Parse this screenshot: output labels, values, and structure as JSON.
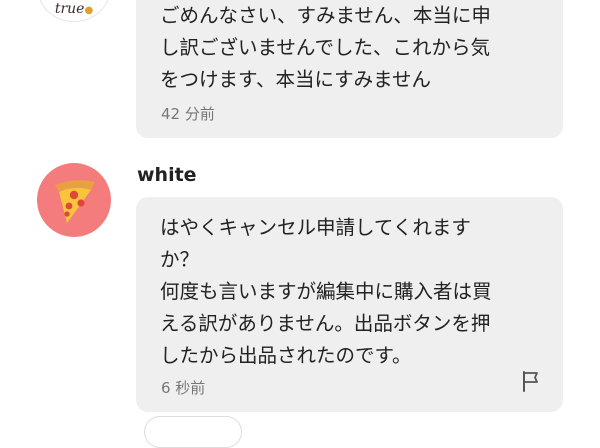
{
  "messages": [
    {
      "logo_text": "true",
      "text": "ごめんなさい、すみません、本当に申\nし訳ございませんでした、これから気\nをつけます、本当にすみません",
      "time": "42 分前"
    },
    {
      "username": "white",
      "text": "はやくキャンセル申請してくれます\nか？\n何度も言いますが編集中に購入者は買\nえる訳がありません。出品ボタンを押\nしたから出品されたのです。",
      "time": "6 秒前"
    }
  ],
  "colors": {
    "bubble": "#efefef",
    "avatar": "#f47c7c"
  },
  "icons": {
    "avatar": "pizza-icon",
    "report": "flag-icon"
  }
}
